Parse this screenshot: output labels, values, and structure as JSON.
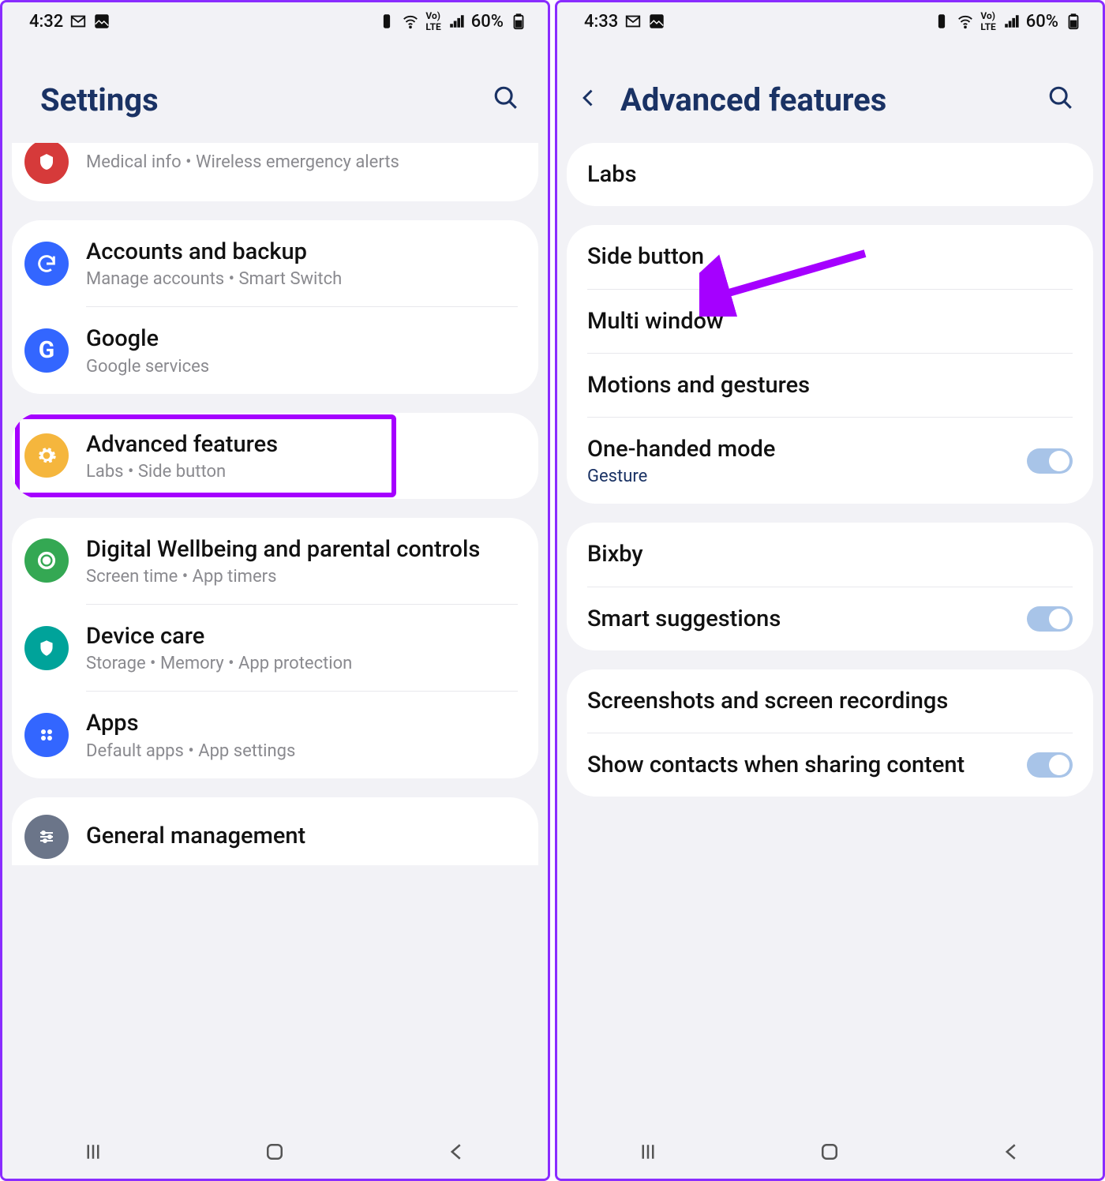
{
  "left": {
    "status": {
      "time": "4:32",
      "battery": "60%"
    },
    "title": "Settings",
    "partial": {
      "subtitle": "Medical info  •  Wireless emergency alerts"
    },
    "g1": [
      {
        "title": "Accounts and backup",
        "subtitle": "Manage accounts  •  Smart Switch",
        "iconColor": "#3366ff"
      },
      {
        "title": "Google",
        "subtitle": "Google services",
        "iconColor": "#3366ff"
      }
    ],
    "g2": [
      {
        "title": "Advanced features",
        "subtitle": "Labs  •  Side button",
        "iconColor": "#f5b63d"
      }
    ],
    "g3": [
      {
        "title": "Digital Wellbeing and parental controls",
        "subtitle": "Screen time  •  App timers",
        "iconColor": "#34a853"
      },
      {
        "title": "Device care",
        "subtitle": "Storage  •  Memory  •  App protection",
        "iconColor": "#00a39a"
      },
      {
        "title": "Apps",
        "subtitle": "Default apps  •  App settings",
        "iconColor": "#3366ff"
      }
    ],
    "g4": [
      {
        "title": "General management"
      }
    ]
  },
  "right": {
    "status": {
      "time": "4:33",
      "battery": "60%"
    },
    "title": "Advanced features",
    "g1": [
      {
        "title": "Labs"
      }
    ],
    "g2": [
      {
        "title": "Side button"
      },
      {
        "title": "Multi window"
      },
      {
        "title": "Motions and gestures"
      },
      {
        "title": "One-handed mode",
        "subtitle": "Gesture",
        "toggle": true
      }
    ],
    "g3": [
      {
        "title": "Bixby"
      },
      {
        "title": "Smart suggestions",
        "toggle": true
      }
    ],
    "g4": [
      {
        "title": "Screenshots and screen recordings"
      },
      {
        "title": "Show contacts when sharing content",
        "toggle": true
      }
    ]
  }
}
